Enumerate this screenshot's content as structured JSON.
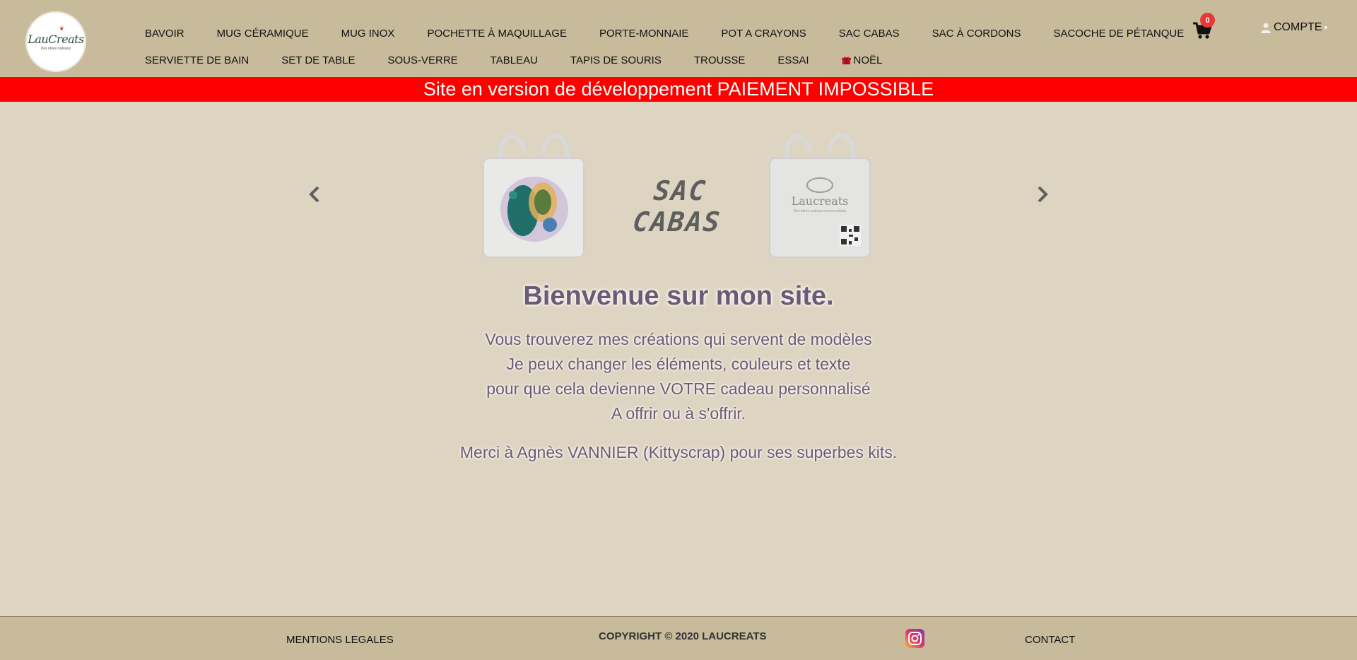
{
  "brand": {
    "logo_text": "LauCreats",
    "logo_tagline": "Des idées cadeaux"
  },
  "nav": {
    "row1": [
      "BAVOIR",
      "MUG CÉRAMIQUE",
      "MUG INOX",
      "POCHETTE À MAQUILLAGE",
      "PORTE-MONNAIE",
      "POT A CRAYONS",
      "SAC CABAS",
      "SAC À CORDONS",
      "SACOCHE DE PÉTANQUE"
    ],
    "row2": [
      "SERVIETTE DE BAIN",
      "SET DE TABLE",
      "SOUS-VERRE",
      "TABLEAU",
      "TAPIS DE SOURIS",
      "TROUSSE",
      "ESSAI",
      "NOËL"
    ],
    "gift_icon": "gift-icon"
  },
  "cart": {
    "count": "0",
    "icon": "shopping-cart-icon"
  },
  "account": {
    "label": "COMPTE",
    "icon": "user-icon"
  },
  "dev_banner": "Site en version de développement PAIEMENT IMPOSSIBLE",
  "carousel": {
    "title": "SAC CABAS",
    "bag_right_text": "Laucreats",
    "bag_right_subtext": "Des idées cadeaux personnalisés"
  },
  "welcome": {
    "title": "Bienvenue sur mon site.",
    "lines": [
      "Vous trouverez mes créations qui servent de modèles",
      "Je peux changer les éléments, couleurs et texte",
      "pour que cela devienne VOTRE cadeau personnalisé",
      "A offrir ou à s'offrir."
    ],
    "thanks": "Merci à Agnès VANNIER (Kittyscrap) pour ses superbes kits."
  },
  "footer": {
    "legal": "MENTIONS LEGALES",
    "copyright": "COPYRIGHT © 2020 LAUCREATS",
    "contact": "CONTACT",
    "instagram_icon": "instagram-icon"
  },
  "colors": {
    "header_bg": "#c7bb9c",
    "body_bg": "#ddd5c1",
    "banner_bg": "#ff0000",
    "text_purple": "#6e5a74",
    "badge_red": "#e53935"
  }
}
